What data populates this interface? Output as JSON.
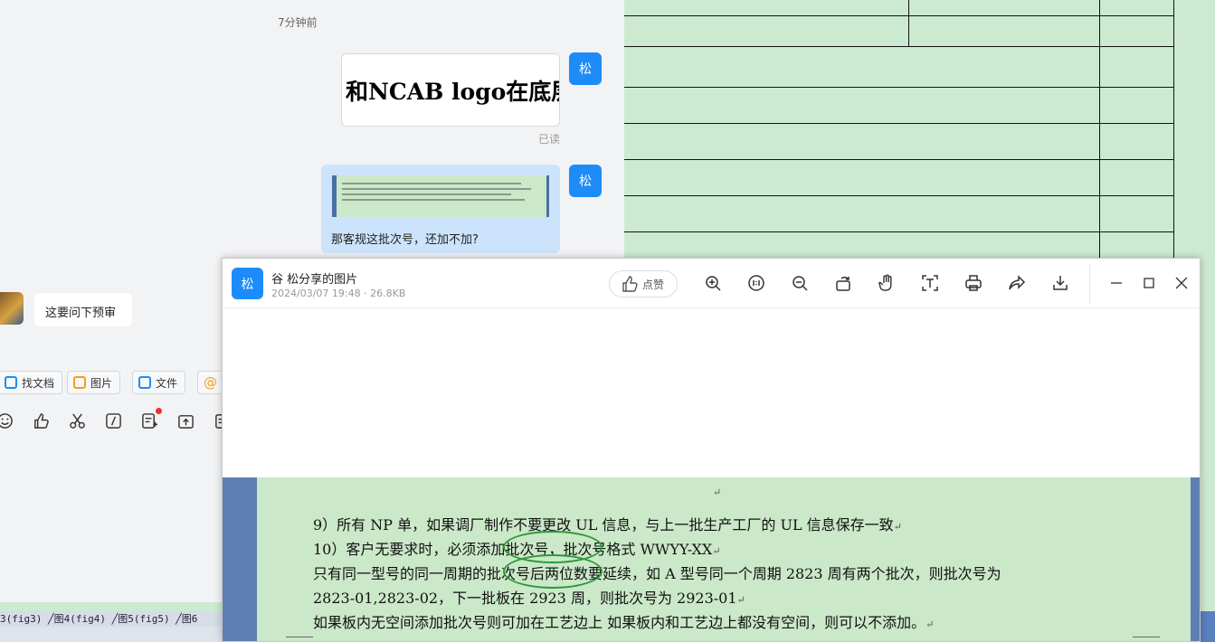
{
  "chat": {
    "time": "7分钟前",
    "self_avatar": "松",
    "image_msg_text": "和NCAB logo在底层",
    "read_status": "已读",
    "text_msg": "那客规这批次号，还加不加?",
    "other_msg": "这要问下预审"
  },
  "quick_actions": [
    {
      "label": "找文档",
      "icon": "doc-search-icon"
    },
    {
      "label": "图片",
      "icon": "image-icon"
    },
    {
      "label": "文件",
      "icon": "folder-icon"
    }
  ],
  "input_toolbar_icons": [
    "emoji-icon",
    "thumbs-up-icon",
    "scissors-icon",
    "slash-command-icon",
    "task-icon",
    "upload-icon",
    "clipboard-icon"
  ],
  "sheet_tabs": "3(fig3) ╱图4(fig4) ╱图5(fig5) ╱图6",
  "viewer": {
    "avatar": "松",
    "title": "谷  松分享的图片",
    "meta": "2024/03/07 19:48 · 26.8KB",
    "like_label": "点赞",
    "tools": [
      "zoom-in-icon",
      "actual-size-icon",
      "zoom-out-icon",
      "rotate-icon",
      "pan-hand-icon",
      "ocr-text-icon",
      "print-icon",
      "share-icon",
      "download-icon"
    ],
    "window_controls": [
      "minimize-icon",
      "maximize-icon",
      "close-icon"
    ]
  },
  "document": {
    "para_mark": "↵",
    "lines": [
      "9）所有 NP 单，如果调厂制作不要更改 UL 信息，与上一批生产工厂的 UL 信息保存一致",
      "10）客户无要求时，必须添加批次号，批次号格式 WWYY-XX",
      "只有同一型号的同一周期的批次号后两位数要延续，如 A 型号同一个周期 2823 周有两个批次，则批次号为",
      "2823-01,2823-02，下一批板在 2923 周，则批次号为 2923-01",
      "如果板内无空间添加批次号则可加在工艺边上  如果板内和工艺边上都没有空间，则可以不添加。"
    ],
    "line_marks": [
      "↵",
      "↵",
      "",
      "↵",
      "↵"
    ]
  },
  "colors": {
    "accent": "#1d8cf8",
    "sheet_bg": "#ccead0",
    "doc_frame": "#5f7fb3",
    "annotation": "#2a9a3a"
  }
}
